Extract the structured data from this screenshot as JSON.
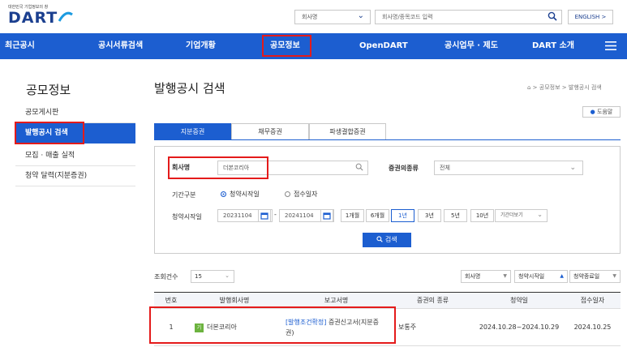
{
  "header": {
    "logo_sub": "대한민국 기업정보의 창",
    "logo": "DART",
    "search_type": "회사명",
    "search_placeholder": "회사명/종목코드 입력",
    "lang_button": "ENGLISH >"
  },
  "gnb": [
    "최근공시",
    "공시서류검색",
    "기업개황",
    "공모정보",
    "OpenDART",
    "공시업무 · 제도",
    "DART 소개"
  ],
  "lnb": {
    "title": "공모정보",
    "items": [
      "공모게시판",
      "발행공시 검색",
      "모집 · 매출 실적",
      "청약 달력(지분증권)"
    ]
  },
  "page": {
    "title": "발행공시 검색",
    "breadcrumb": [
      "공모정보",
      "발행공시 검색"
    ],
    "help": "도움말"
  },
  "tabs": [
    "지분증권",
    "채무증권",
    "파생결합증권"
  ],
  "form": {
    "company_label": "회사명",
    "company_value": "더본코리아",
    "security_label": "증권의종류",
    "security_value": "전체",
    "period_label": "기간구분",
    "radio1": "청약시작일",
    "radio2": "접수일자",
    "start_label": "청약시작일",
    "date_from": "20231104",
    "date_sep": "-",
    "date_to": "20241104",
    "periods": [
      "1개월",
      "6개월",
      "1년",
      "3년",
      "5년",
      "10년"
    ],
    "period_more": "기간더보기",
    "search_button": "검색"
  },
  "list": {
    "count_label": "조회건수",
    "count_value": "15",
    "sort": [
      "회사명",
      "청약시작일",
      "청약종료일"
    ],
    "headers": [
      "번호",
      "발행회사명",
      "보고서명",
      "증권의 종류",
      "청약일",
      "접수일자"
    ],
    "rows": [
      {
        "no": "1",
        "badge": "기",
        "company": "더본코리아",
        "report_prefix": "[발행조건확정]",
        "report_rest": " 증권신고서(지분증권)",
        "type": "보통주",
        "subscription": "2024.10.28~2024.10.29",
        "received": "2024.10.25"
      }
    ]
  },
  "colors": {
    "primary": "#1c5ed0",
    "highlight": "#e41b1b",
    "badge": "#6cb33f"
  }
}
